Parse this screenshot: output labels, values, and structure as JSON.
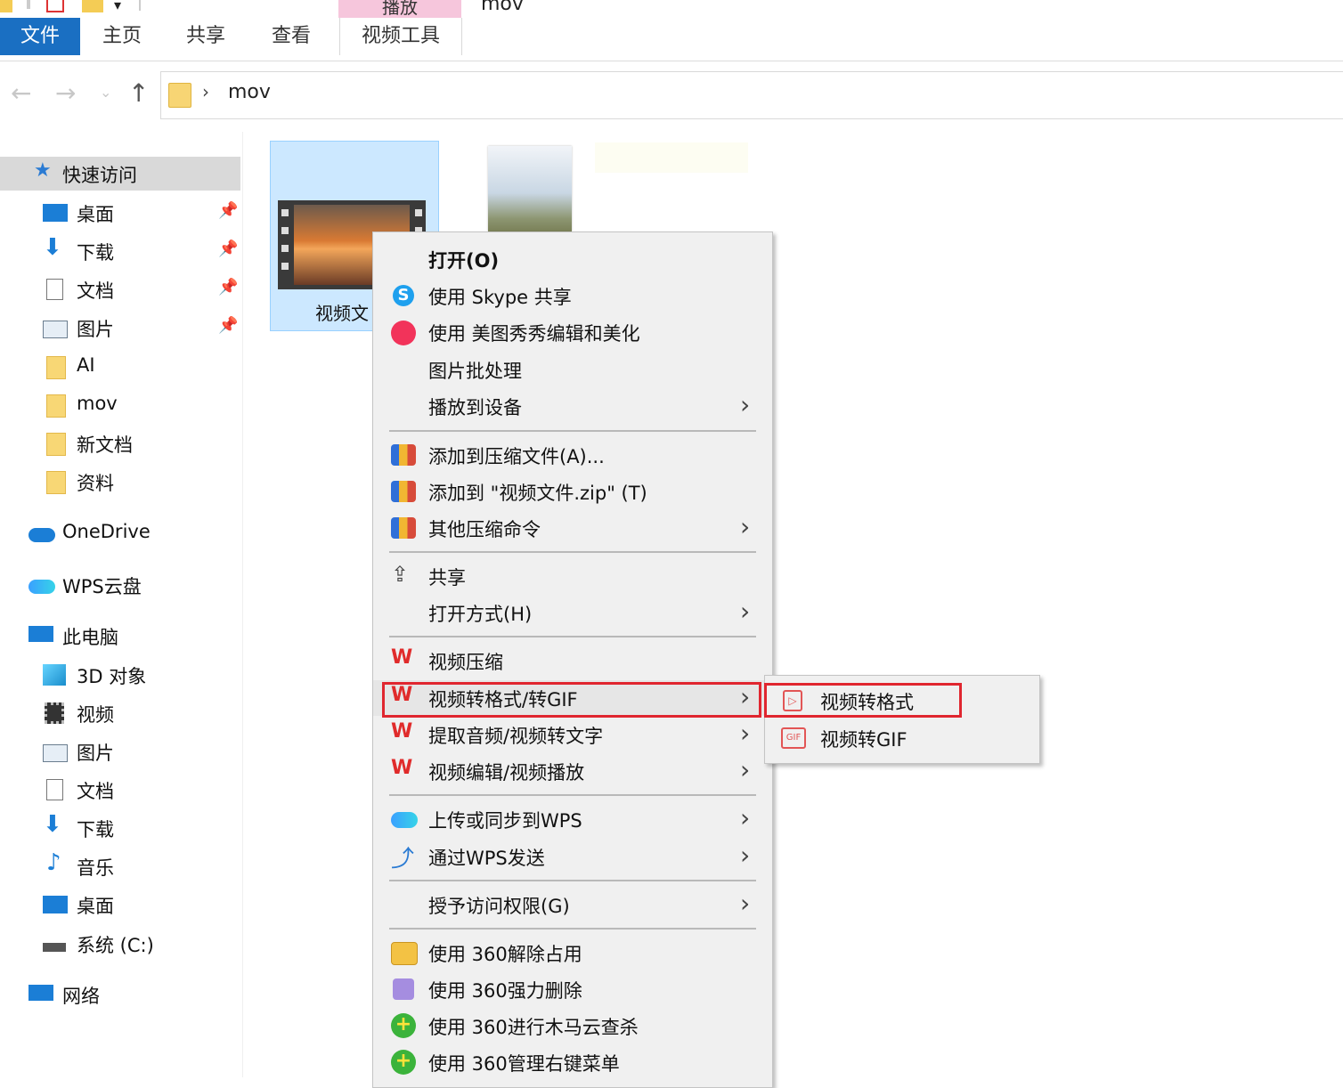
{
  "title_bar": {
    "context_tab_header": "播放",
    "window_title": "mov"
  },
  "ribbon": {
    "tabs": [
      {
        "label": "文件"
      },
      {
        "label": "主页"
      },
      {
        "label": "共享"
      },
      {
        "label": "查看"
      },
      {
        "label": "视频工具"
      }
    ]
  },
  "address": {
    "separator": "›",
    "path": "mov"
  },
  "nav_pane": {
    "quick_access": "快速访问",
    "items": [
      {
        "label": "桌面"
      },
      {
        "label": "下载"
      },
      {
        "label": "文档"
      },
      {
        "label": "图片"
      },
      {
        "label": "AI"
      },
      {
        "label": "mov"
      },
      {
        "label": "新文档"
      },
      {
        "label": "资料"
      }
    ],
    "onedrive": "OneDrive",
    "wps_cloud": "WPS云盘",
    "this_pc": "此电脑",
    "pc_items": [
      {
        "label": "3D 对象"
      },
      {
        "label": "视频"
      },
      {
        "label": "图片"
      },
      {
        "label": "文档"
      },
      {
        "label": "下载"
      },
      {
        "label": "音乐"
      },
      {
        "label": "桌面"
      },
      {
        "label": "系统 (C:)"
      }
    ],
    "network": "网络"
  },
  "files": {
    "selected_label": "视频文"
  },
  "context_menu": {
    "items": [
      {
        "label": "打开(O)"
      },
      {
        "label": "使用 Skype 共享"
      },
      {
        "label": "使用 美图秀秀编辑和美化"
      },
      {
        "label": "图片批处理"
      },
      {
        "label": "播放到设备"
      },
      {
        "label": "添加到压缩文件(A)..."
      },
      {
        "label": "添加到 \"视频文件.zip\" (T)"
      },
      {
        "label": "其他压缩命令"
      },
      {
        "label": "共享"
      },
      {
        "label": "打开方式(H)"
      },
      {
        "label": "视频压缩"
      },
      {
        "label": "视频转格式/转GIF"
      },
      {
        "label": "提取音频/视频转文字"
      },
      {
        "label": "视频编辑/视频播放"
      },
      {
        "label": "上传或同步到WPS"
      },
      {
        "label": "通过WPS发送"
      },
      {
        "label": "授予访问权限(G)"
      },
      {
        "label": "使用 360解除占用"
      },
      {
        "label": "使用 360强力删除"
      },
      {
        "label": "使用 360进行木马云查杀"
      },
      {
        "label": "使用 360管理右键菜单"
      }
    ]
  },
  "submenu": {
    "items": [
      {
        "label": "视频转格式"
      },
      {
        "label": "视频转GIF"
      }
    ]
  },
  "colors": {
    "file_tab": "#1a6fc2",
    "highlight_box": "#e0262f",
    "selection": "#cce8ff"
  }
}
